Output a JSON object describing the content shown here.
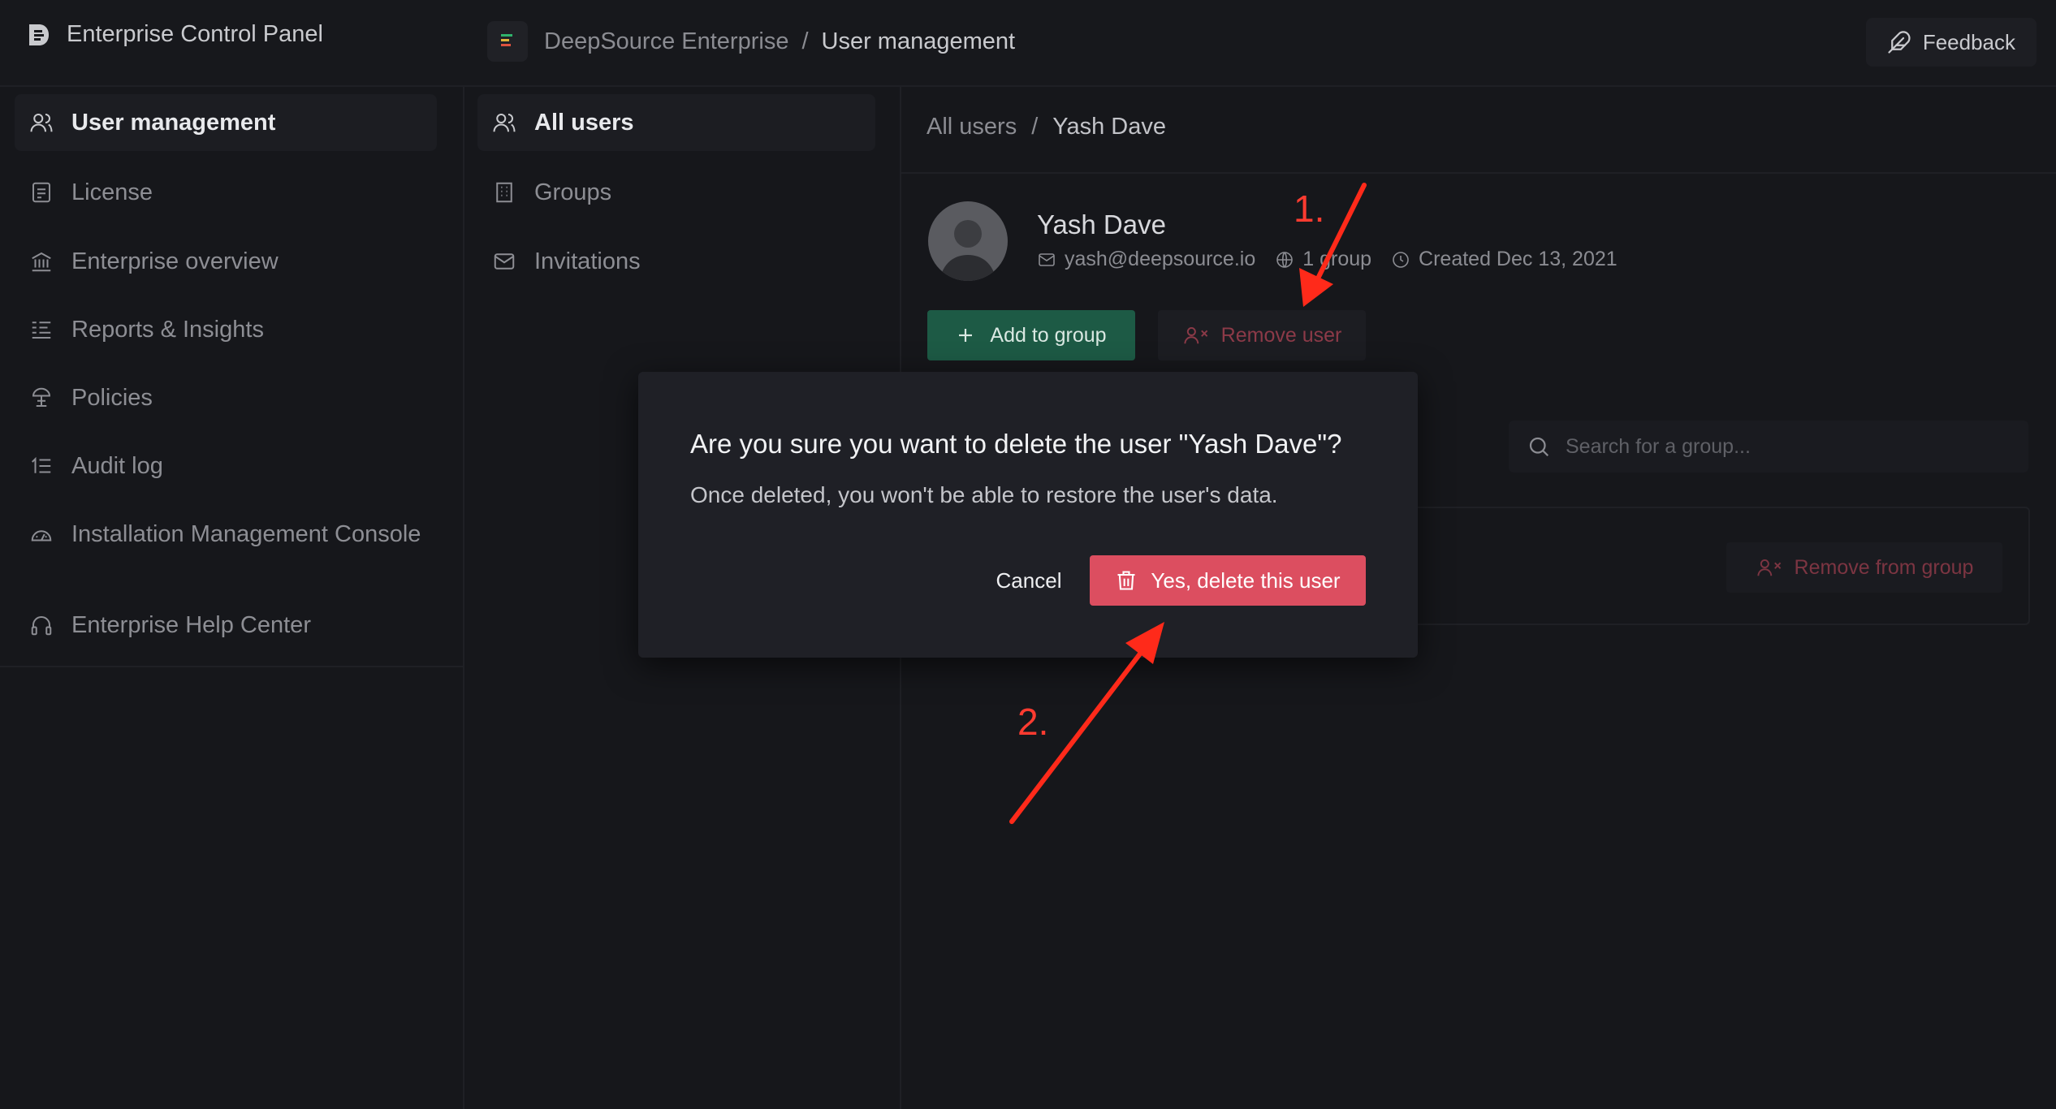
{
  "app": {
    "title": "Enterprise Control Panel"
  },
  "breadcrumb": {
    "org": "DeepSource Enterprise",
    "sep": "/",
    "page": "User management"
  },
  "feedback": {
    "label": "Feedback"
  },
  "sidebar": {
    "items": [
      {
        "label": "User management",
        "icon": "users-icon",
        "active": true
      },
      {
        "label": "License",
        "icon": "license-icon"
      },
      {
        "label": "Enterprise overview",
        "icon": "bank-icon"
      },
      {
        "label": "Reports & Insights",
        "icon": "reports-icon"
      },
      {
        "label": "Policies",
        "icon": "policies-icon"
      },
      {
        "label": "Audit log",
        "icon": "audit-log-icon"
      },
      {
        "label": "Installation Management Console",
        "icon": "console-icon"
      }
    ],
    "help": {
      "label": "Enterprise Help Center",
      "icon": "headphones-icon"
    }
  },
  "subnav": {
    "items": [
      {
        "label": "All users",
        "icon": "users-icon",
        "active": true
      },
      {
        "label": "Groups",
        "icon": "building-icon"
      },
      {
        "label": "Invitations",
        "icon": "mail-icon"
      }
    ]
  },
  "main": {
    "crumb": {
      "parent": "All users",
      "sep": "/",
      "current": "Yash Dave"
    },
    "user": {
      "name": "Yash Dave",
      "email": "yash@deepsource.io",
      "groups": "1 group",
      "created": "Created Dec 13, 2021"
    },
    "add_to_group": "Add to group",
    "remove_user": "Remove user",
    "search_placeholder": "Search for a group...",
    "remove_from_group": "Remove from group"
  },
  "modal": {
    "title": "Are you sure you want to delete the user \"Yash Dave\"?",
    "text": "Once deleted, you won't be able to restore the user's data.",
    "cancel": "Cancel",
    "confirm": "Yes, delete this user"
  },
  "annotations": {
    "step1": "1.",
    "step2": "2.",
    "color": "#ff3b30"
  },
  "colors": {
    "accent_green": "#1d5a45",
    "danger": "#dc4e60",
    "background": "#16171b"
  }
}
